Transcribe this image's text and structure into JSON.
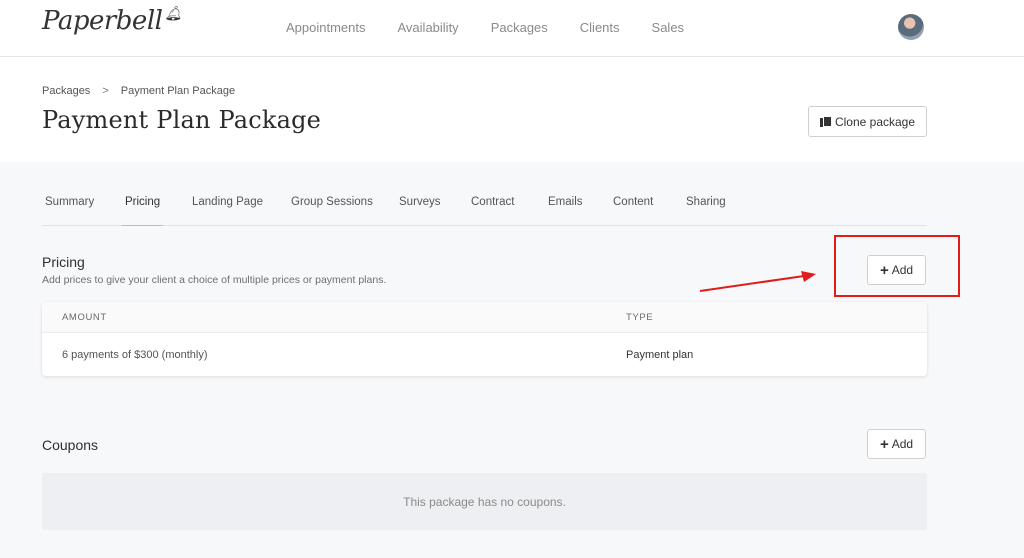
{
  "app": {
    "logo": "Paperbell"
  },
  "nav": {
    "items": [
      {
        "label": "Appointments"
      },
      {
        "label": "Availability"
      },
      {
        "label": "Packages"
      },
      {
        "label": "Clients"
      },
      {
        "label": "Sales"
      }
    ]
  },
  "breadcrumb": {
    "parent": "Packages",
    "current": "Payment Plan Package"
  },
  "page": {
    "title": "Payment Plan Package",
    "clone_label": "Clone package"
  },
  "tabs": [
    {
      "label": "Summary"
    },
    {
      "label": "Pricing",
      "active": true
    },
    {
      "label": "Landing Page"
    },
    {
      "label": "Group Sessions"
    },
    {
      "label": "Surveys"
    },
    {
      "label": "Contract"
    },
    {
      "label": "Emails"
    },
    {
      "label": "Content"
    },
    {
      "label": "Sharing"
    }
  ],
  "pricing": {
    "title": "Pricing",
    "subtitle": "Add prices to give your client a choice of multiple prices or payment plans.",
    "add_label": "Add",
    "columns": {
      "amount": "AMOUNT",
      "type": "TYPE"
    },
    "rows": [
      {
        "amount": "6 payments of $300 (monthly)",
        "type": "Payment plan"
      }
    ]
  },
  "coupons": {
    "title": "Coupons",
    "add_label": "Add",
    "empty_text": "This package has no coupons."
  },
  "colors": {
    "annotation": "#e21b1b",
    "background": "#f7f8fa"
  },
  "icons": {
    "clone": "copy-icon",
    "add": "plus-icon",
    "logo_mark": "bell-icon"
  }
}
